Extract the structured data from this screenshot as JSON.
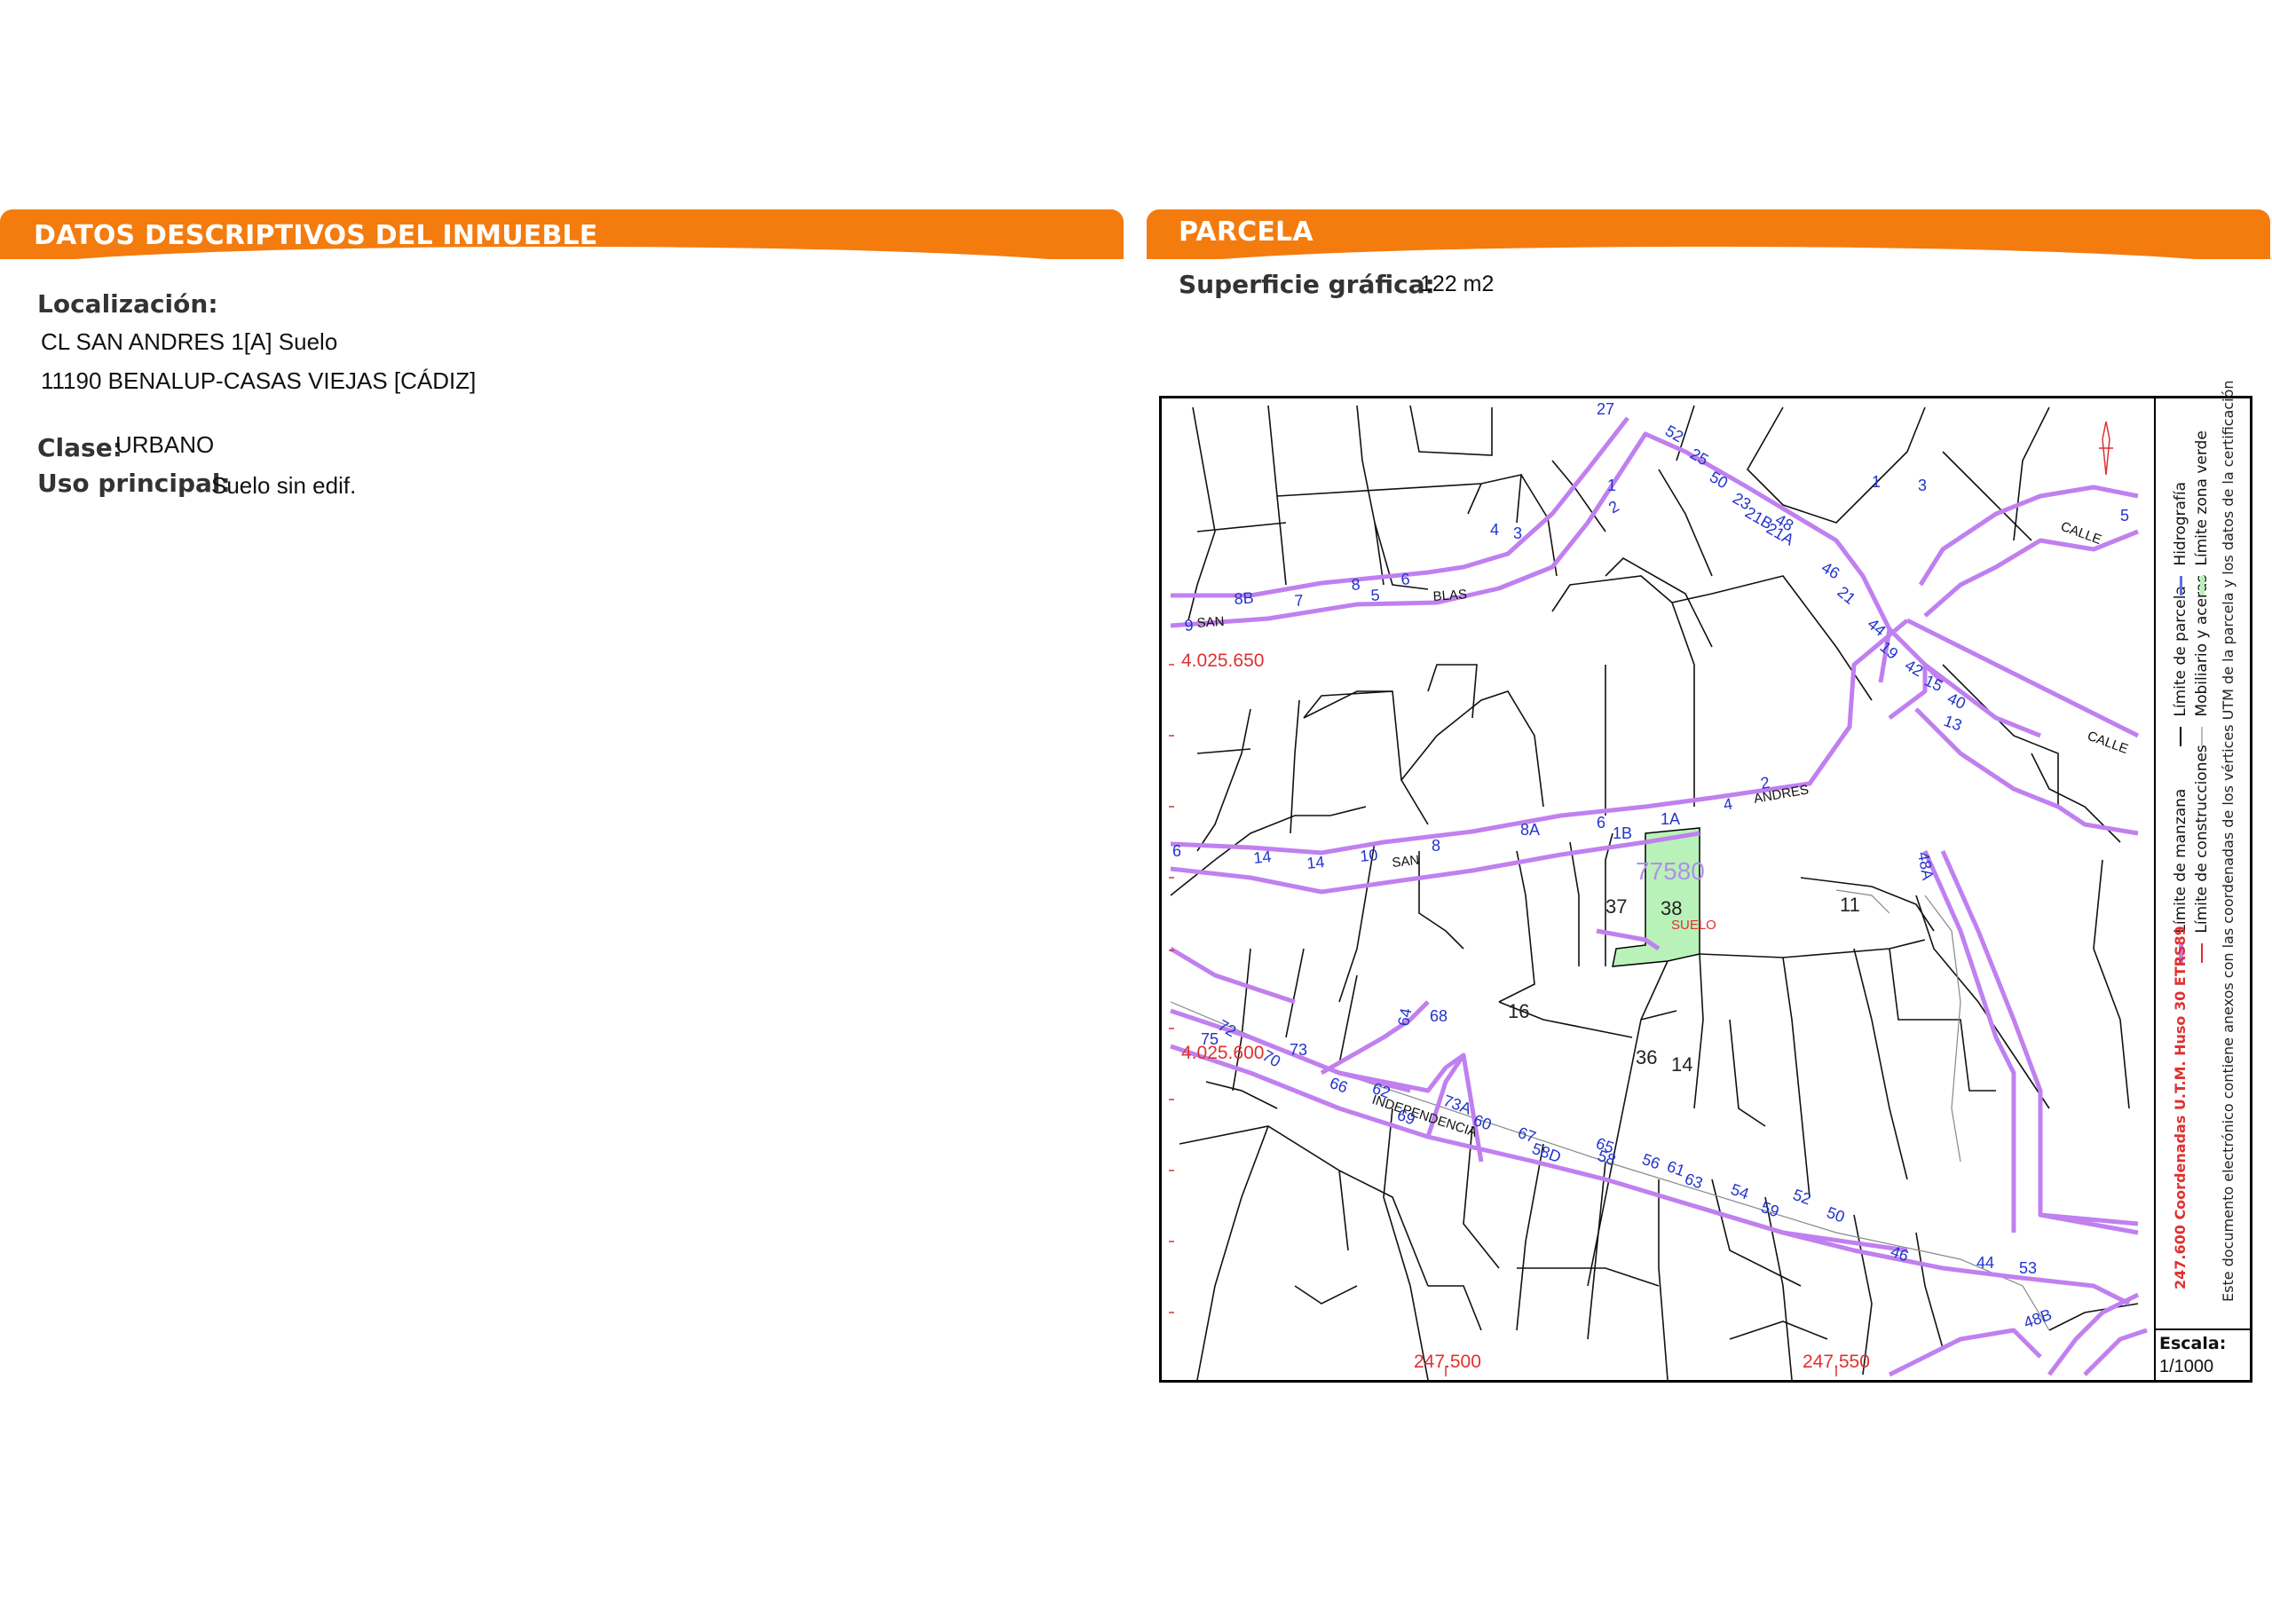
{
  "left_panel": {
    "title": "DATOS DESCRIPTIVOS DEL INMUEBLE",
    "localizacion_label": "Localización:",
    "address_line1": "CL SAN ANDRES 1[A] Suelo",
    "address_line2": "11190 BENALUP-CASAS VIEJAS [CÁDIZ]",
    "clase_label": "Clase:",
    "clase_value": "URBANO",
    "uso_label": "Uso principal:",
    "uso_value": "Suelo sin edif."
  },
  "right_panel": {
    "title": "PARCELA",
    "superficie_label": "Superficie gráfica:",
    "superficie_value": "122 m2"
  },
  "map": {
    "parcel_id": "77580",
    "parcel_label": "SUELO",
    "escala_label": "Escala:",
    "escala_value": "1/1000",
    "coordinate_labels": [
      "4.025.650",
      "4.025.600",
      "247.500",
      "247.550"
    ],
    "street_words": [
      "SAN",
      "BLAS",
      "ANDRES",
      "SAN",
      "INDEPENDENCIA",
      "CALLE",
      "CALLE"
    ],
    "block_numbers": [
      "37",
      "38",
      "11",
      "16",
      "36",
      "14"
    ],
    "house_numbers": [
      "27",
      "52",
      "25",
      "50",
      "23",
      "48",
      "21B",
      "21A",
      "46",
      "21",
      "44",
      "19",
      "42",
      "15",
      "40",
      "13",
      "1",
      "3",
      "5",
      "2",
      "1",
      "4",
      "3",
      "6",
      "8",
      "5",
      "7",
      "8B",
      "9",
      "2",
      "4",
      "1A",
      "1B",
      "6",
      "8A",
      "8",
      "10",
      "14",
      "14",
      "6",
      "72",
      "75",
      "70",
      "73",
      "66",
      "64",
      "68",
      "62",
      "73A",
      "69",
      "60",
      "67",
      "58D",
      "65",
      "58",
      "56",
      "63",
      "61",
      "54",
      "59",
      "52",
      "50",
      "46",
      "44",
      "53",
      "48B",
      "48A"
    ],
    "colors": {
      "manzana": "#c080f0",
      "parcela": "#000000",
      "zona_verde": "#b9f2b9",
      "coordenadas": "#e03030",
      "hidrografia": "#5b6ee0",
      "numbers": "#2233cc"
    },
    "legend": {
      "col1": [
        "Límite de manzana",
        "Límite de parcela",
        "Hidrografía"
      ],
      "col2": [
        "Límite de construcciones",
        "Mobiliario y aceras",
        "Límite zona verde"
      ],
      "coords_note": "247.600 Coordenadas U.T.M. Huso 30 ETRS89",
      "electronic_note": "Este documento electrónico contiene anexos con las coordenadas de los vértices UTM de la parcela y los datos de la certificación"
    }
  }
}
